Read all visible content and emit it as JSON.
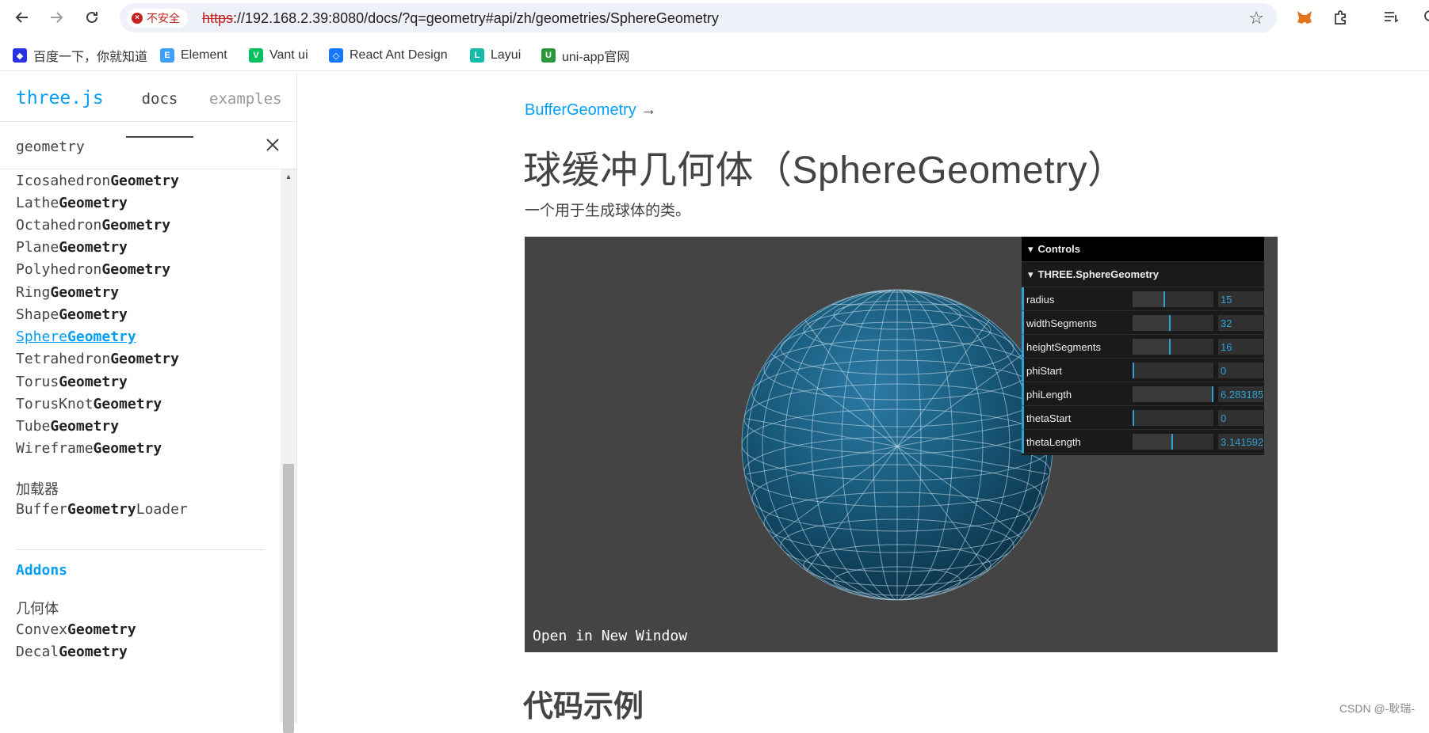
{
  "browser": {
    "security_label": "不安全",
    "url_protocol": "https",
    "url_rest": "://192.168.2.39:8080/docs/?q=geometry#api/zh/geometries/SphereGeometry"
  },
  "bookmarks": [
    {
      "label": "百度一下，你就知道",
      "icon": "baidu-icon",
      "color": "#2932e1"
    },
    {
      "label": "Element",
      "icon": "element-icon",
      "color": "#409eff"
    },
    {
      "label": "Vant ui",
      "icon": "vant-icon",
      "color": "#07c160"
    },
    {
      "label": "React Ant Design",
      "icon": "antd-icon",
      "color": "#1677ff"
    },
    {
      "label": "Layui",
      "icon": "layui-icon",
      "color": "#16baaa"
    },
    {
      "label": "uni-app官网",
      "icon": "uniapp-icon",
      "color": "#2b9939"
    }
  ],
  "sidebar": {
    "brand": "three.js",
    "tabs": {
      "docs": "docs",
      "examples": "examples"
    },
    "search_value": "geometry",
    "items": [
      {
        "pre": "Icosahedron",
        "bold": "Geometry",
        "post": ""
      },
      {
        "pre": "Lathe",
        "bold": "Geometry",
        "post": ""
      },
      {
        "pre": "Octahedron",
        "bold": "Geometry",
        "post": ""
      },
      {
        "pre": "Plane",
        "bold": "Geometry",
        "post": ""
      },
      {
        "pre": "Polyhedron",
        "bold": "Geometry",
        "post": ""
      },
      {
        "pre": "Ring",
        "bold": "Geometry",
        "post": ""
      },
      {
        "pre": "Shape",
        "bold": "Geometry",
        "post": ""
      },
      {
        "pre": "Sphere",
        "bold": "Geometry",
        "post": ""
      },
      {
        "pre": "Tetrahedron",
        "bold": "Geometry",
        "post": ""
      },
      {
        "pre": "Torus",
        "bold": "Geometry",
        "post": ""
      },
      {
        "pre": "TorusKnot",
        "bold": "Geometry",
        "post": ""
      },
      {
        "pre": "Tube",
        "bold": "Geometry",
        "post": ""
      },
      {
        "pre": "Wireframe",
        "bold": "Geometry",
        "post": ""
      }
    ],
    "loaders_category": "加载器",
    "loader_item": {
      "pre": "Buffer",
      "bold": "Geometry",
      "post": "Loader"
    },
    "addons": "Addons",
    "addons_category": "几何体",
    "addon_items": [
      {
        "pre": "Convex",
        "bold": "Geometry",
        "post": ""
      },
      {
        "pre": "Decal",
        "bold": "Geometry",
        "post": ""
      }
    ]
  },
  "main": {
    "parent_link": "BufferGeometry",
    "parent_arrow": "→",
    "title": "球缓冲几何体（SphereGeometry）",
    "description": "一个用于生成球体的类。",
    "open_window": "Open in New Window",
    "gui": {
      "title": "Controls",
      "folder": "THREE.SphereGeometry",
      "rows": [
        {
          "label": "radius",
          "value": "15",
          "fraction": 0.4
        },
        {
          "label": "widthSegments",
          "value": "32",
          "fraction": 0.47
        },
        {
          "label": "heightSegments",
          "value": "16",
          "fraction": 0.47
        },
        {
          "label": "phiStart",
          "value": "0",
          "fraction": 0.0
        },
        {
          "label": "phiLength",
          "value": "6.283185",
          "fraction": 1.0
        },
        {
          "label": "thetaStart",
          "value": "0",
          "fraction": 0.0
        },
        {
          "label": "thetaLength",
          "value": "3.141592",
          "fraction": 0.5
        }
      ]
    },
    "section_heading": "代码示例"
  },
  "watermark": "CSDN @-耿瑞-"
}
